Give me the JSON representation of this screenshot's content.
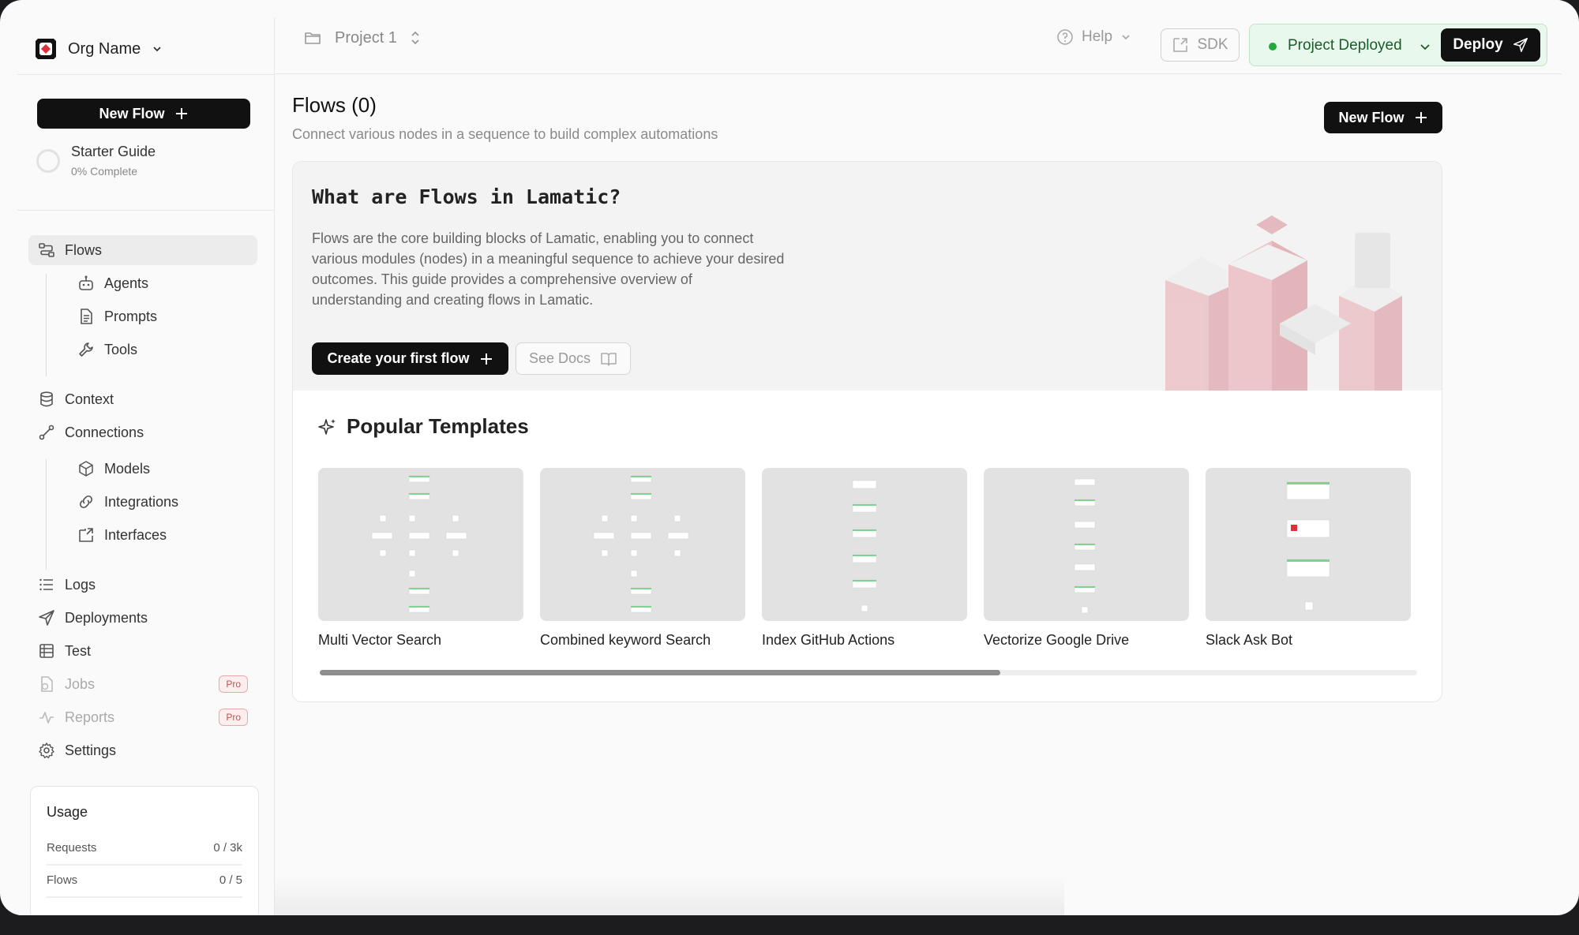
{
  "org": {
    "name": "Org Name"
  },
  "sidebar": {
    "new_flow_label": "New Flow",
    "starter": {
      "title": "Starter Guide",
      "progress_text": "0% Complete"
    },
    "nav": {
      "flows": "Flows",
      "agents": "Agents",
      "prompts": "Prompts",
      "tools": "Tools",
      "context": "Context",
      "connections": "Connections",
      "models": "Models",
      "integrations": "Integrations",
      "interfaces": "Interfaces",
      "logs": "Logs",
      "deployments": "Deployments",
      "test": "Test",
      "jobs": "Jobs",
      "reports": "Reports",
      "settings": "Settings",
      "pro_badge": "Pro"
    },
    "usage": {
      "title": "Usage",
      "rows": [
        {
          "label": "Requests",
          "value": "0 / 3k"
        },
        {
          "label": "Flows",
          "value": "0 / 5"
        }
      ]
    }
  },
  "topbar": {
    "project": "Project 1",
    "help": "Help",
    "sdk": "SDK",
    "status": "Project Deployed",
    "deploy": "Deploy"
  },
  "main": {
    "title": "Flows (0)",
    "subtitle": "Connect various nodes in a sequence to build complex automations",
    "new_flow_label": "New Flow",
    "hero": {
      "title": "What are Flows in Lamatic?",
      "body": "Flows are the core building blocks of Lamatic, enabling you to connect various modules (nodes) in a meaningful sequence to achieve your desired outcomes. This guide provides a comprehensive overview of understanding and creating flows in Lamatic.",
      "create_label": "Create your first flow",
      "docs_label": "See Docs"
    },
    "templates_title": "Popular Templates",
    "templates": [
      {
        "name": "Multi Vector Search"
      },
      {
        "name": "Combined keyword Search"
      },
      {
        "name": "Index GitHub Actions"
      },
      {
        "name": "Vectorize Google Drive"
      },
      {
        "name": "Slack Ask Bot"
      }
    ],
    "scroll_fraction": 0.62
  },
  "colors": {
    "accent_dark": "#111111",
    "deploy_bg": "#e9f8ec",
    "deploy_dot": "#22a83c",
    "pro_red": "#d14b4b"
  }
}
